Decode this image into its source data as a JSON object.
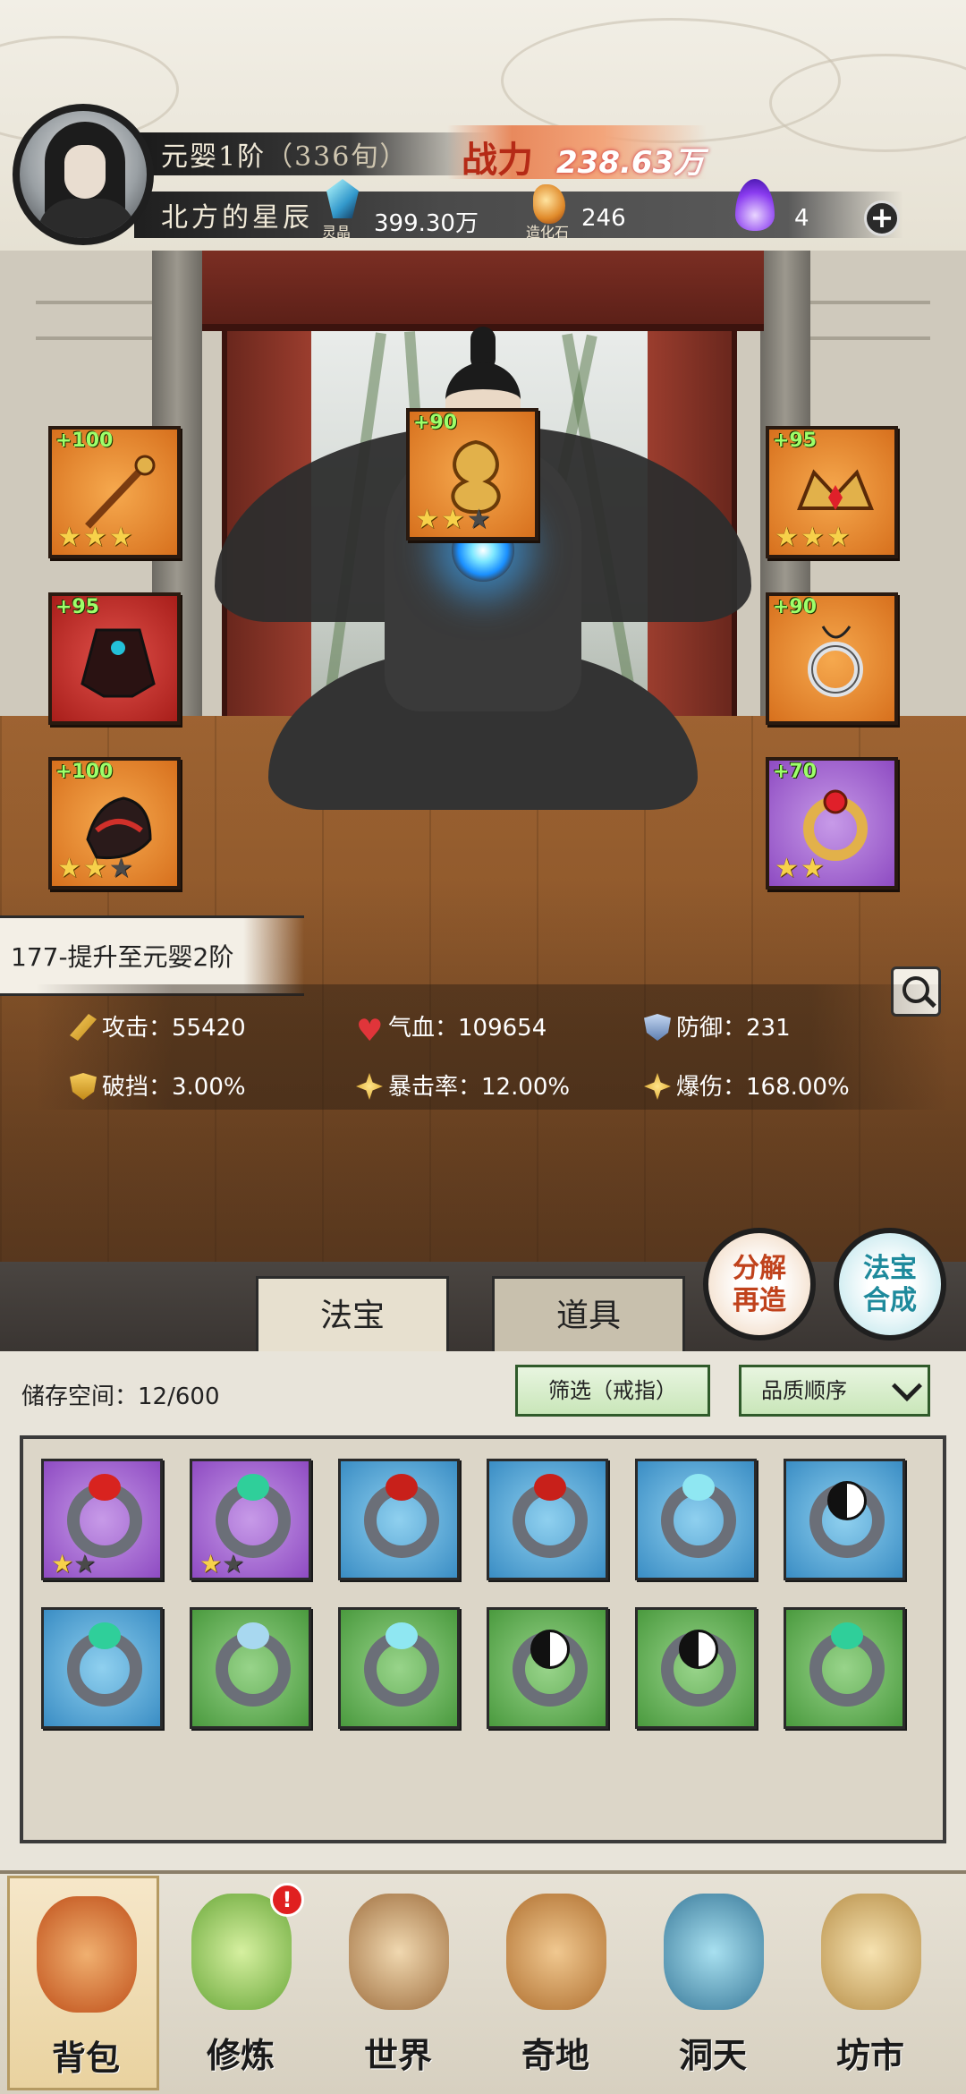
{
  "header": {
    "rank": "元婴1阶",
    "age": "（336旬）",
    "player_name": "北方的星辰",
    "power_label": "战力",
    "power_value": "238.63万",
    "resources": [
      {
        "icon": "spirit-crystal-icon",
        "caption": "灵晶",
        "value": "399.30万"
      },
      {
        "icon": "creation-stone-icon",
        "caption": "造化石",
        "value": "246"
      },
      {
        "icon": "purple-flame-icon",
        "caption": "",
        "value": "4"
      }
    ],
    "add_button": "+"
  },
  "equipment": {
    "left": [
      {
        "name": "staff",
        "level": "+100",
        "stars": 3,
        "max_stars": 3,
        "quality": "orange"
      },
      {
        "name": "robe",
        "level": "+95",
        "stars": 0,
        "max_stars": 0,
        "quality": "red"
      },
      {
        "name": "boots",
        "level": "+100",
        "stars": 2,
        "max_stars": 3,
        "quality": "orange"
      }
    ],
    "center": {
      "name": "gourd-talisman",
      "level": "+90",
      "stars": 2,
      "max_stars": 3,
      "quality": "orange"
    },
    "right": [
      {
        "name": "crown",
        "level": "+95",
        "stars": 3,
        "max_stars": 3,
        "quality": "orange"
      },
      {
        "name": "pendant",
        "level": "+90",
        "stars": 0,
        "max_stars": 0,
        "quality": "orange"
      },
      {
        "name": "ring",
        "level": "+70",
        "stars": 2,
        "max_stars": 2,
        "quality": "purple"
      }
    ]
  },
  "promo_text": "177-提升至元婴2阶",
  "stats": {
    "attack": "攻击：55420",
    "hp": "气血：109654",
    "defense": "防御：231",
    "break_block": "破挡：3.00%",
    "crit_rate": "暴击率：12.00%",
    "crit_damage": "爆伤：168.00%"
  },
  "actions": {
    "dismantle": [
      "分解",
      "再造"
    ],
    "synthesize": [
      "法宝",
      "合成"
    ]
  },
  "tabs": {
    "treasure": "法宝",
    "items": "道具"
  },
  "inventory": {
    "storage_label": "储存空间：",
    "storage_value": "12/600",
    "filter_label": "筛选（戒指）",
    "sort_label": "品质顺序",
    "items": [
      {
        "quality": "purple",
        "gem": "#d8231f",
        "stars": 1,
        "max_stars": 2
      },
      {
        "quality": "purple",
        "gem": "#2fcf9a",
        "stars": 1,
        "max_stars": 2
      },
      {
        "quality": "blue",
        "gem": "#c8201a",
        "stars": 0,
        "max_stars": 0
      },
      {
        "quality": "blue",
        "gem": "#c8201a",
        "stars": 0,
        "max_stars": 0
      },
      {
        "quality": "blue",
        "gem": "#8fe7f2",
        "stars": 0,
        "max_stars": 0
      },
      {
        "quality": "blue",
        "gem": "yinyang",
        "stars": 0,
        "max_stars": 0
      },
      {
        "quality": "blue",
        "gem": "#2fcf9a",
        "stars": 0,
        "max_stars": 0
      },
      {
        "quality": "green",
        "gem": "#a8d8f0",
        "stars": 0,
        "max_stars": 0
      },
      {
        "quality": "green",
        "gem": "#8fe7f2",
        "stars": 0,
        "max_stars": 0
      },
      {
        "quality": "green",
        "gem": "yinyang",
        "stars": 0,
        "max_stars": 0
      },
      {
        "quality": "green",
        "gem": "yinyang",
        "stars": 0,
        "max_stars": 0
      },
      {
        "quality": "green",
        "gem": "#2fcf9a",
        "stars": 0,
        "max_stars": 0
      }
    ]
  },
  "nav": [
    {
      "label": "背包",
      "icon": "backpack-icon",
      "active": true,
      "badge": ""
    },
    {
      "label": "修炼",
      "icon": "cultivate-lotus-icon",
      "active": false,
      "badge": "!"
    },
    {
      "label": "世界",
      "icon": "world-scroll-icon",
      "active": false,
      "badge": ""
    },
    {
      "label": "奇地",
      "icon": "mystic-land-icon",
      "active": false,
      "badge": ""
    },
    {
      "label": "洞天",
      "icon": "cave-heaven-icon",
      "active": false,
      "badge": ""
    },
    {
      "label": "坊市",
      "icon": "market-stall-icon",
      "active": false,
      "badge": ""
    }
  ]
}
